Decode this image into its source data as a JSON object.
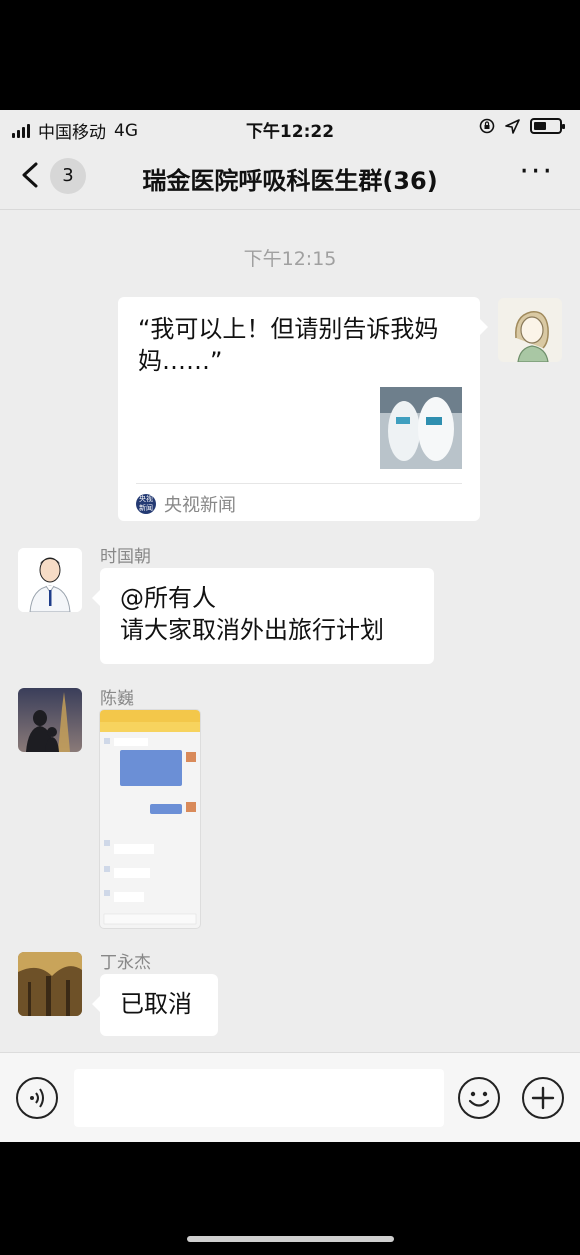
{
  "status_bar": {
    "carrier": "中国移动",
    "network": "4G",
    "time": "下午12:22"
  },
  "nav": {
    "unread_count": "3",
    "title": "瑞金医院呼吸科医生群(36)",
    "more": "···"
  },
  "chat": {
    "timestamp": "下午12:15",
    "shared_card": {
      "title": "“我可以上！但请别告诉我妈妈……”",
      "source": "央视新闻",
      "source_icon_text": "央视 新闻"
    },
    "messages": [
      {
        "sender": "时国朝",
        "text": "@所有人\n请大家取消外出旅行计划"
      },
      {
        "sender": "陈巍",
        "type": "image"
      },
      {
        "sender": "丁永杰",
        "text": "已取消"
      }
    ]
  },
  "colors": {
    "background": "#ededed",
    "bubble": "#ffffff",
    "text": "#111111",
    "muted": "#888888"
  },
  "icons": [
    "back-chevron-icon",
    "more-icon",
    "voice-icon",
    "emoji-icon",
    "add-icon"
  ]
}
